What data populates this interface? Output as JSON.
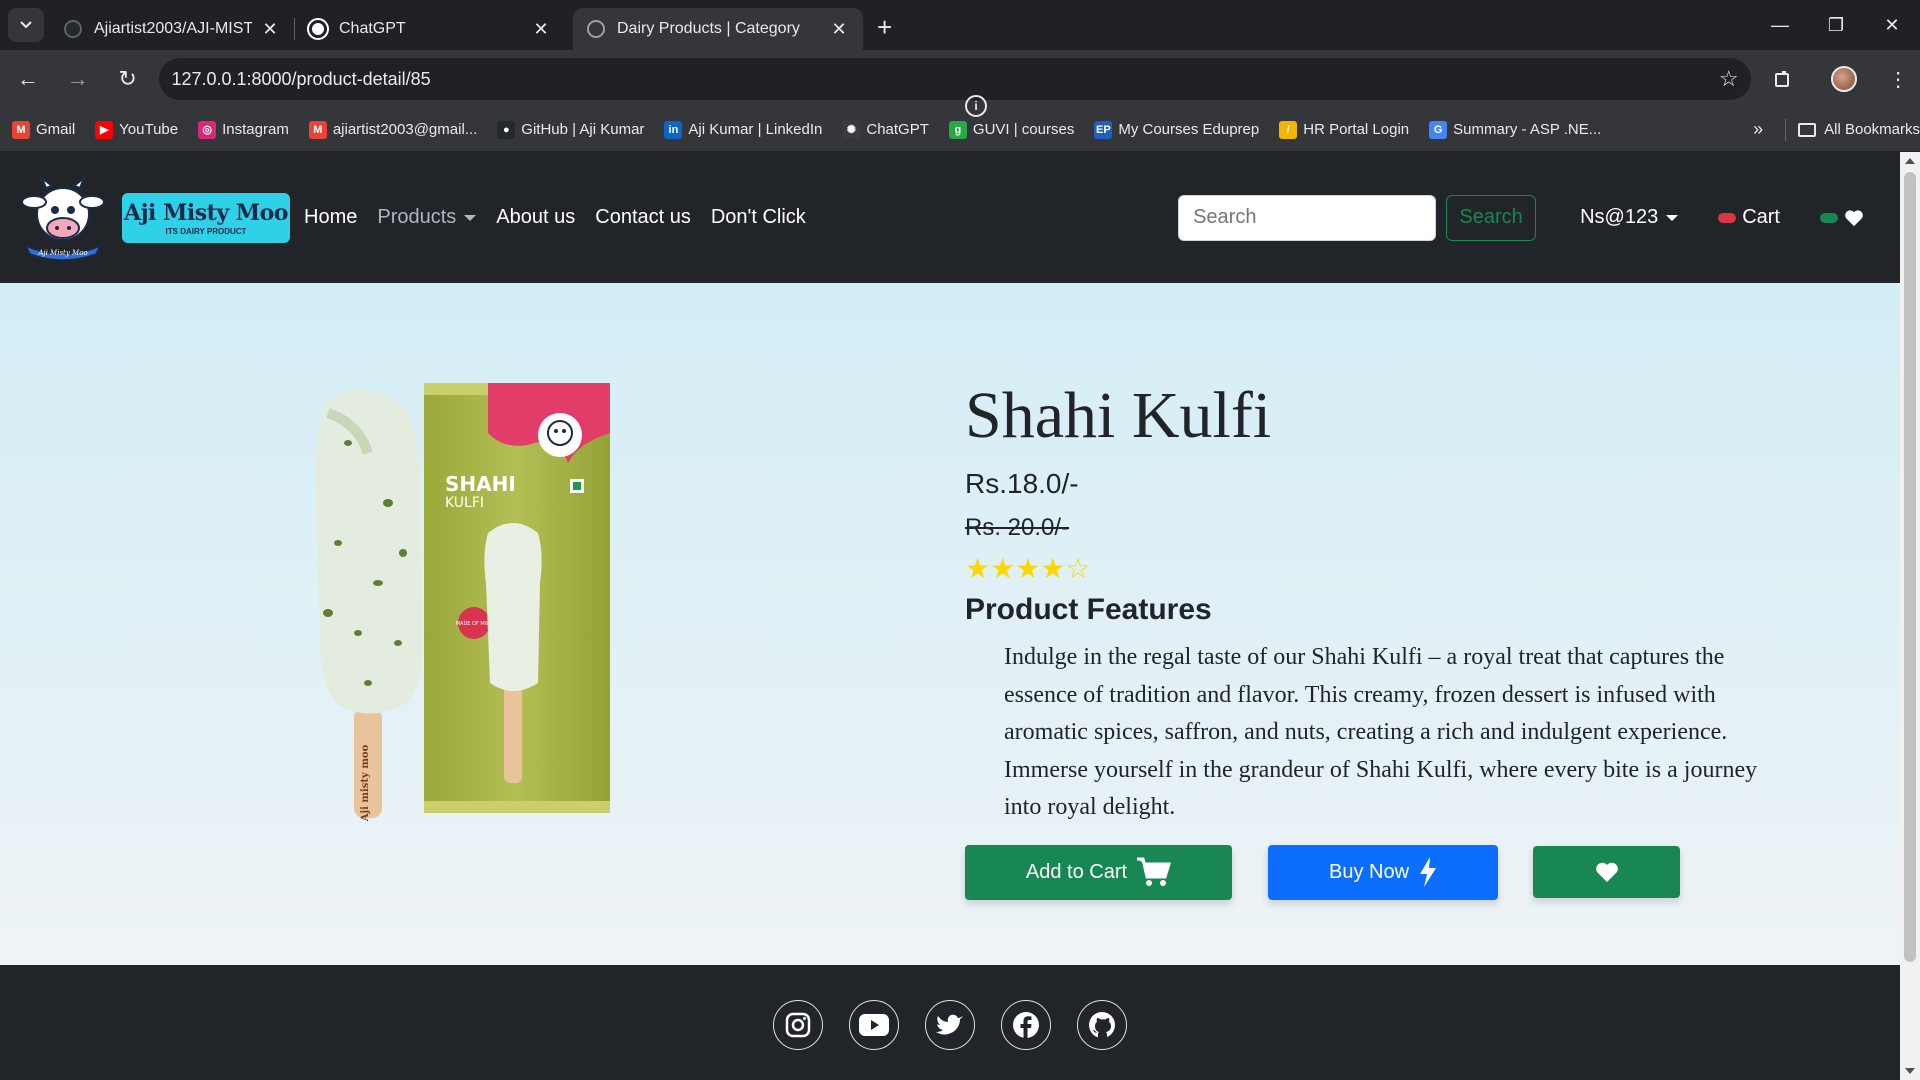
{
  "browser": {
    "tabs": [
      {
        "title": "Ajiartist2003/AJI-MISTY-MOO-",
        "active": false
      },
      {
        "title": "ChatGPT",
        "active": false
      },
      {
        "title": "Dairy Products | Category",
        "active": true
      }
    ],
    "url": "127.0.0.1:8000/product-detail/85",
    "bookmarks": [
      {
        "label": "Gmail",
        "icon": "gmail-icon",
        "color": "#ea4335",
        "glyph": "M"
      },
      {
        "label": "YouTube",
        "icon": "youtube-icon",
        "color": "#ff0000",
        "glyph": "▶"
      },
      {
        "label": "Instagram",
        "icon": "instagram-icon",
        "color": "#d62976",
        "glyph": "◎"
      },
      {
        "label": "ajiartist2003@gmail...",
        "icon": "gmail-icon",
        "color": "#ea4335",
        "glyph": "M"
      },
      {
        "label": "GitHub | Aji Kumar",
        "icon": "github-icon",
        "color": "#24292e",
        "glyph": "●"
      },
      {
        "label": "Aji Kumar | LinkedIn",
        "icon": "linkedin-icon",
        "color": "#0a66c2",
        "glyph": "in"
      },
      {
        "label": "ChatGPT",
        "icon": "chatgpt-icon",
        "color": "#3a3b3f",
        "glyph": "✺"
      },
      {
        "label": "GUVI | courses",
        "icon": "guvi-icon",
        "color": "#27a745",
        "glyph": "g"
      },
      {
        "label": "My Courses Eduprep",
        "icon": "eduprep-icon",
        "color": "#1e5fbf",
        "glyph": "EP"
      },
      {
        "label": "HR Portal Login",
        "icon": "hr-portal-icon",
        "color": "#f4b400",
        "glyph": "/"
      },
      {
        "label": "Summary - ASP .NE...",
        "icon": "google-icon",
        "color": "#4285f4",
        "glyph": "G"
      }
    ],
    "all_bookmarks_label": "All Bookmarks"
  },
  "site": {
    "brand_name": "Aji Misty Moo",
    "brand_tagline": "ITS DAIRY PRODUCT",
    "logo_text": "Aji Misty Moo",
    "nav": {
      "home": "Home",
      "products": "Products",
      "about": "About us",
      "contact": "Contact us",
      "dont_click": "Don't Click"
    },
    "search": {
      "placeholder": "Search",
      "button": "Search"
    },
    "user": "Ns@123",
    "cart": "Cart",
    "colors": {
      "navbar": "#212529",
      "green": "#198754",
      "blue": "#0d6efd",
      "cart_pill": "#dc3545",
      "heart_pill": "#198754"
    }
  },
  "product": {
    "title": "Shahi Kulfi",
    "price": "Rs.18.0/-",
    "old_price": "Rs. 20.0/-",
    "rating": 4,
    "rating_max": 5,
    "stars": "★★★★☆",
    "features_heading": "Product Features",
    "description": "Indulge in the regal taste of our Shahi Kulfi – a royal treat that captures the essence of tradition and flavor. This creamy, frozen dessert is infused with aromatic spices, saffron, and nuts, creating a rich and indulgent experience. Immerse yourself in the grandeur of Shahi Kulfi, where every bite is a journey into royal delight.",
    "packaging": {
      "line1": "SHAHI",
      "line2": "KULFI",
      "badge": "MADE OF MILK",
      "stick_text": "Aji misty moo"
    },
    "actions": {
      "add_to_cart": "Add to Cart",
      "buy_now": "Buy Now"
    }
  },
  "footer": {
    "social": [
      "instagram-icon",
      "youtube-icon",
      "twitter-icon",
      "facebook-icon",
      "github-icon"
    ]
  }
}
